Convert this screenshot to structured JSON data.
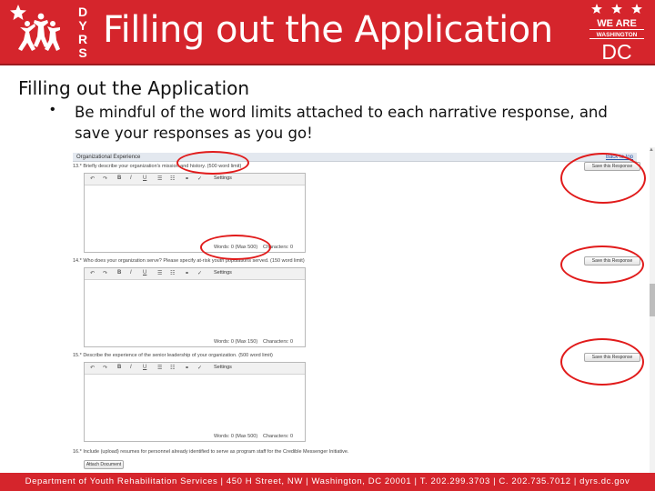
{
  "header": {
    "title": "Filling out the Application",
    "dyrs_letters": [
      "D",
      "Y",
      "R",
      "S"
    ],
    "dc_logo_lines": [
      "WE ARE",
      "WASHINGTON",
      "DC"
    ],
    "brand_color": "#d5252c"
  },
  "content": {
    "subtitle": "Filling out the Application",
    "bullet_symbol": "•",
    "bullet_text": "Be mindful of the word limits attached to each narrative response, and save your responses as you go!"
  },
  "screenshot": {
    "section_title": "Organizational Experience",
    "back_link": "Back to top",
    "questions": [
      {
        "label": "13.* Briefly describe your organization's mission and history. (500 word limit)",
        "save_label": "Save this Response",
        "settings_label": "Settings",
        "words_label": "Words: 0 (Max 500)",
        "chars_label": "Characters: 0"
      },
      {
        "label": "14.* Who does your organization serve? Please specify at-risk youth populations served. (150 word limit)",
        "save_label": "Save this Response",
        "settings_label": "Settings",
        "words_label": "Words: 0 (Max 150)",
        "chars_label": "Characters: 0"
      },
      {
        "label": "15.* Describe the experience of the senior leadership of your organization. (500 word limit)",
        "save_label": "Save this Response",
        "settings_label": "Settings",
        "words_label": "Words: 0 (Max 500)",
        "chars_label": "Characters: 0"
      }
    ],
    "question_16_label": "16.* Include (upload) resumes for personnel already identified to serve as program staff for the Credible Messenger Initiative.",
    "attach_label": "Attach Document",
    "toolbar_icons": [
      "undo-icon",
      "redo-icon",
      "bold-icon",
      "italic-icon",
      "underline-icon",
      "bullet-list-icon",
      "numbered-list-icon",
      "link-icon",
      "spellcheck-icon"
    ]
  },
  "footer": {
    "text": "Department of Youth Rehabilitation Services | 450 H Street, NW | Washington, DC 20001 | T. 202.299.3703 | C. 202.735.7012 | dyrs.dc.gov"
  },
  "colors": {
    "highlight": "#e11b1b",
    "header_red": "#d5252c"
  }
}
